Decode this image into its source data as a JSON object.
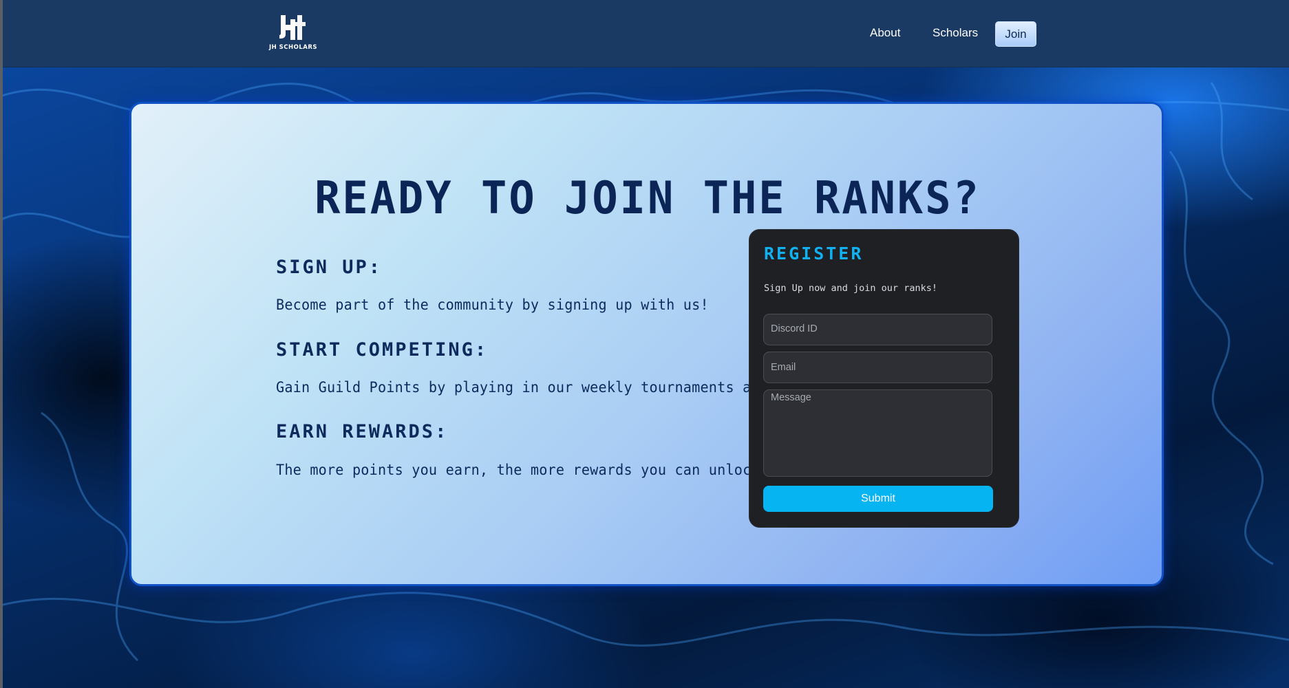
{
  "nav": {
    "logo_text": "JH SCHOLARS",
    "links": [
      {
        "label": "About"
      },
      {
        "label": "Scholars"
      },
      {
        "label": "Join"
      }
    ]
  },
  "hero": {
    "headline": "READY TO JOIN THE RANKS?"
  },
  "steps": [
    {
      "heading": "SIGN UP:",
      "text": "Become part of the community by signing up with us!"
    },
    {
      "heading": "START COMPETING:",
      "text": "Gain Guild Points by playing in our weekly tournaments and events."
    },
    {
      "heading": "EARN REWARDS:",
      "text": "The more points you earn, the more rewards you can unlock!"
    }
  ],
  "register": {
    "title": "REGISTER",
    "subtitle": "Sign Up now and join our ranks!",
    "discord_placeholder": "Discord ID",
    "email_placeholder": "Email",
    "message_placeholder": "Message",
    "submit_label": "Submit"
  },
  "colors": {
    "navbar": "#1b3a63",
    "accent": "#07b4f2",
    "headline": "#0c2557",
    "panel": "#1e2024"
  }
}
